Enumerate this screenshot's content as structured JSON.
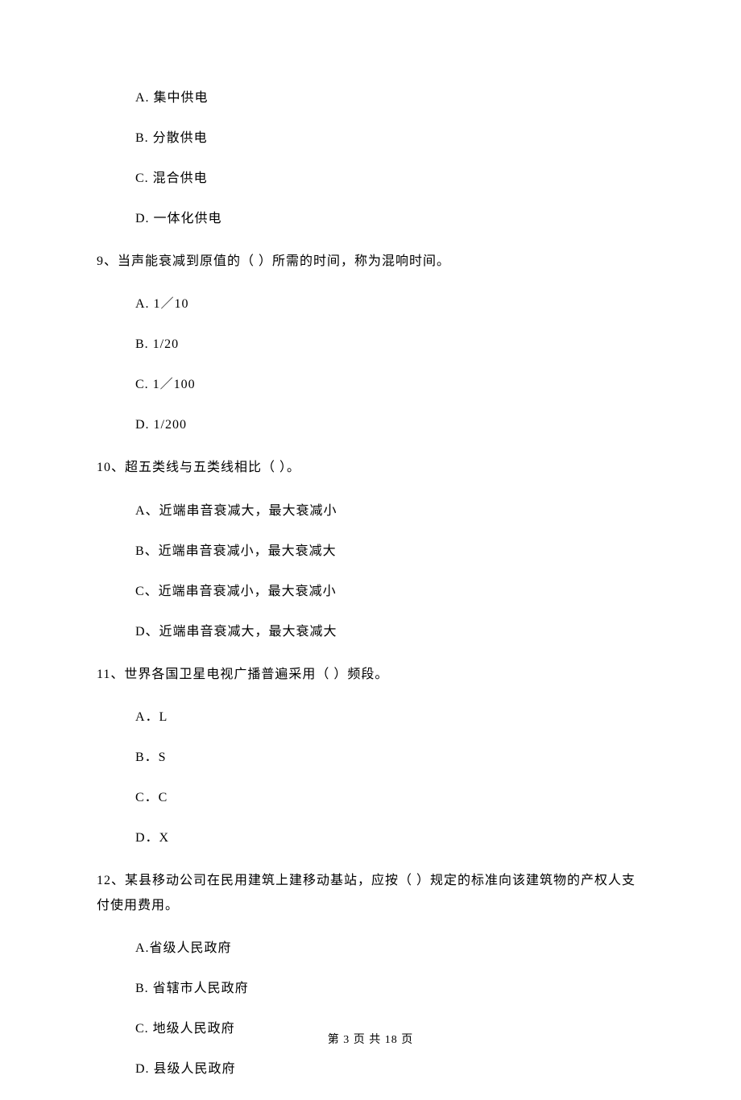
{
  "q8": {
    "options": {
      "A": "A. 集中供电",
      "B": "B. 分散供电",
      "C": "C. 混合供电",
      "D": "D. 一体化供电"
    }
  },
  "q9": {
    "stem": "9、当声能衰减到原值的（    ）所需的时间，称为混响时间。",
    "options": {
      "A": "A.  1／10",
      "B": "B.  1/20",
      "C": "C.  1／100",
      "D": "D.  1/200"
    }
  },
  "q10": {
    "stem": "10、超五类线与五类线相比（    ）。",
    "options": {
      "A": "A、近端串音衰减大，最大衰减小",
      "B": "B、近端串音衰减小，最大衰减大",
      "C": "C、近端串音衰减小，最大衰减小",
      "D": "D、近端串音衰减大，最大衰减大"
    }
  },
  "q11": {
    "stem": "11、世界各国卫星电视广播普遍采用（    ）频段。",
    "options": {
      "A": "A．L",
      "B": "B．S",
      "C": "C．C",
      "D": "D．X"
    }
  },
  "q12": {
    "stem": "12、某县移动公司在民用建筑上建移动基站，应按（    ）规定的标准向该建筑物的产权人支付使用费用。",
    "options": {
      "A": "A.省级人民政府",
      "B": "B. 省辖市人民政府",
      "C": "C. 地级人民政府",
      "D": "D. 县级人民政府"
    }
  },
  "footer": "第 3 页 共 18 页"
}
